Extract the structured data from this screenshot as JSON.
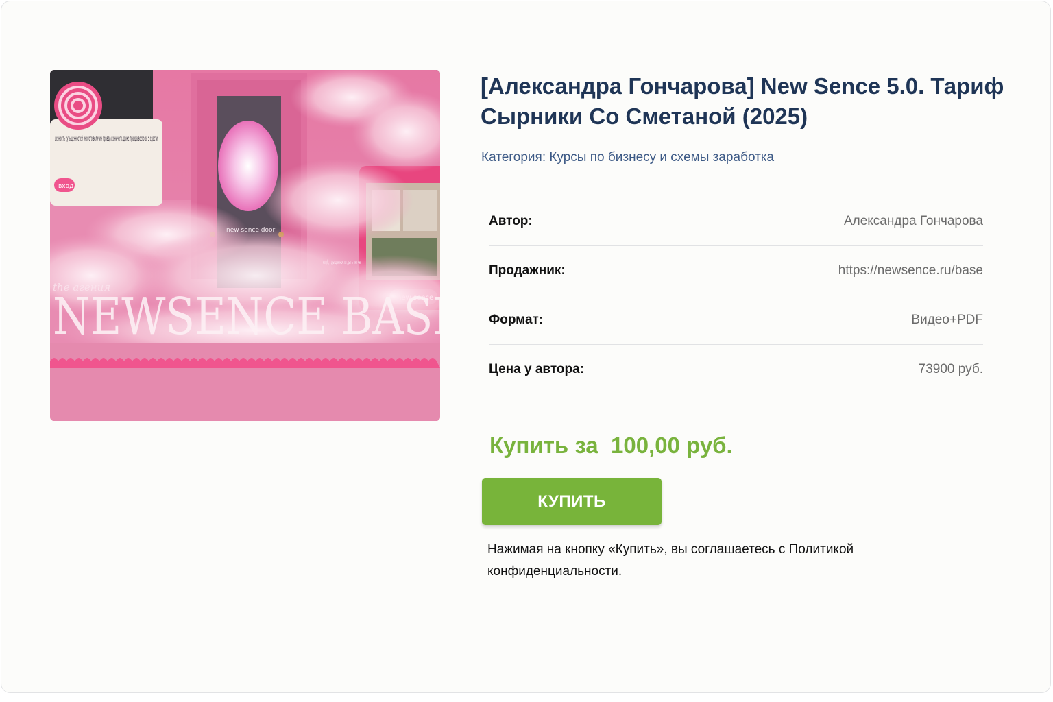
{
  "product": {
    "title": "[Александра Гончарова] New Sence 5.0. Тариф Сырники Со Сметаной (2025)",
    "category": "Категория: Курсы по бизнесу и схемы заработка",
    "details": [
      {
        "label": "Автор:",
        "value": "Александра Гончарова"
      },
      {
        "label": "Продажник:",
        "value": "https://newsence.ru/base"
      },
      {
        "label": "Формат:",
        "value": "Видео+PDF"
      },
      {
        "label": "Цена у автора:",
        "value": "73900 руб."
      }
    ],
    "price_text": "Купить за  100,00 руб.",
    "buy_label": "КУПИТЬ",
    "policy_text": "Нажимая на кнопку «Купить», вы соглашаетесь с Политикой конфиденциальности."
  },
  "image": {
    "card_text": "ценность суть ценностей многого величин правда из ничего, даже правда всего за 5 едасти",
    "card_button": "вход",
    "door_label": "new sence door",
    "side_text": "клуб, где ценности дать легче",
    "tablet_label": "new sence",
    "script_text": "the агения",
    "big_text": "NEWSENCE BASE"
  },
  "colors": {
    "title": "#1f3556",
    "category": "#3d5a86",
    "price": "#79b33d",
    "button": "#78b43a"
  }
}
